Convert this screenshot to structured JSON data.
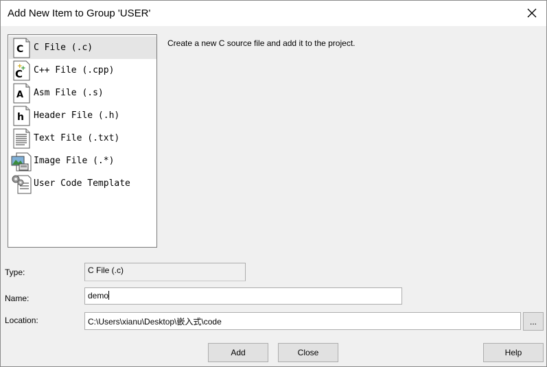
{
  "window": {
    "title": "Add New Item to Group 'USER'"
  },
  "file_types": [
    {
      "label": "C File (.c)",
      "icon": "c-file-icon",
      "selected": true
    },
    {
      "label": "C++ File (.cpp)",
      "icon": "cpp-file-icon",
      "selected": false
    },
    {
      "label": "Asm File (.s)",
      "icon": "asm-file-icon",
      "selected": false
    },
    {
      "label": "Header File (.h)",
      "icon": "header-file-icon",
      "selected": false
    },
    {
      "label": "Text File (.txt)",
      "icon": "text-file-icon",
      "selected": false
    },
    {
      "label": "Image File (.*)",
      "icon": "image-file-icon",
      "selected": false
    },
    {
      "label": "User Code Template",
      "icon": "user-code-template-icon",
      "selected": false
    }
  ],
  "description": "Create a new C source file and add it to the project.",
  "form": {
    "type_label": "Type:",
    "type_value": "C File (.c)",
    "name_label": "Name:",
    "name_value": "demo",
    "location_label": "Location:",
    "location_value": "C:\\Users\\xianu\\Desktop\\嵌入式\\code",
    "browse_label": "..."
  },
  "buttons": {
    "add": "Add",
    "close": "Close",
    "help": "Help"
  },
  "colors": {
    "selection": "#e5e5e5",
    "button_face": "#e1e1e1",
    "dialog_bg": "#f0f0f0"
  }
}
